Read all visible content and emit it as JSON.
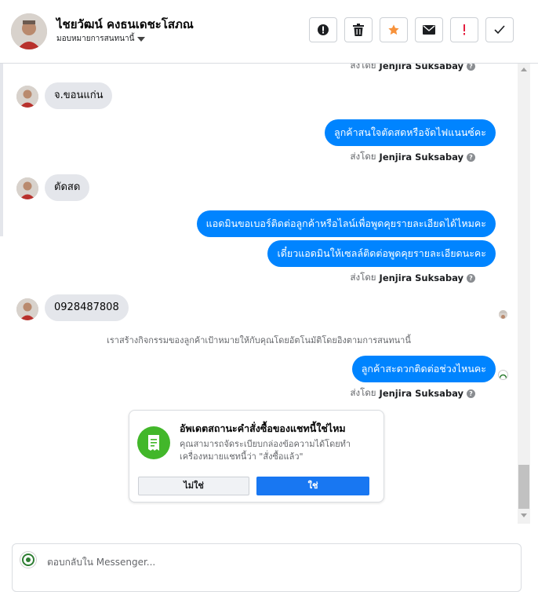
{
  "header": {
    "contact_name": "ไชยวัฒน์ คงธนเดชะโสภณ",
    "assign_label": "มอบหมายการสนทนานี้",
    "actions": [
      {
        "name": "mark-spam-icon"
      },
      {
        "name": "trash-icon"
      },
      {
        "name": "star-icon"
      },
      {
        "name": "mark-unread-icon"
      },
      {
        "name": "follow-up-icon"
      },
      {
        "name": "mark-done-icon"
      }
    ],
    "colors": {
      "star": "#f7923b",
      "follow_up": "#e41e3f"
    }
  },
  "messages": {
    "sent_by_prefix": "ส่งโดย",
    "sent_by_name": "Jenjira Suksabay",
    "incoming_1": "จ.ขอนแก่น",
    "outgoing_1": "ลูกค้าสนใจตัดสดหรือจัดไฟแนนซ์คะ",
    "incoming_2": "ตัดสด",
    "outgoing_2": "แอดมินขอเบอร์ติดต่อลูกค้าหรือไลน์เพื่อพูดคุยรายละเอียดได้ไหมคะ",
    "outgoing_3": "เดี๋ยวแอดมินให้เซลล์ติดต่อพูดคุยรายละเอียดนะคะ",
    "incoming_3": "0928487808",
    "system_notice": "เราสร้างกิจกรรมของลูกค้าเป้าหมายให้กับคุณโดยอัตโนมัติโดยอิงตามการสนทนานี้",
    "outgoing_4": "ลูกค้าสะดวกติดต่อช่วงไหนคะ"
  },
  "card": {
    "title": "อัพเดตสถานะคำสั่งซื้อของแชทนี้ใช่ไหม",
    "body": "คุณสามารถจัดระเบียบกล่องข้อความได้โดยทำเครื่องหมายแชทนี้ว่า \"สั่งซื้อแล้ว\"",
    "no_label": "ไม่ใช่",
    "yes_label": "ใช่",
    "icon": "receipt-icon",
    "accent": "#42b72a"
  },
  "composer": {
    "placeholder": "ตอบกลับใน Messenger..."
  },
  "colors": {
    "outgoing_bubble": "#0084ff",
    "incoming_bubble": "#e4e6eb",
    "primary_button": "#1877f2"
  }
}
